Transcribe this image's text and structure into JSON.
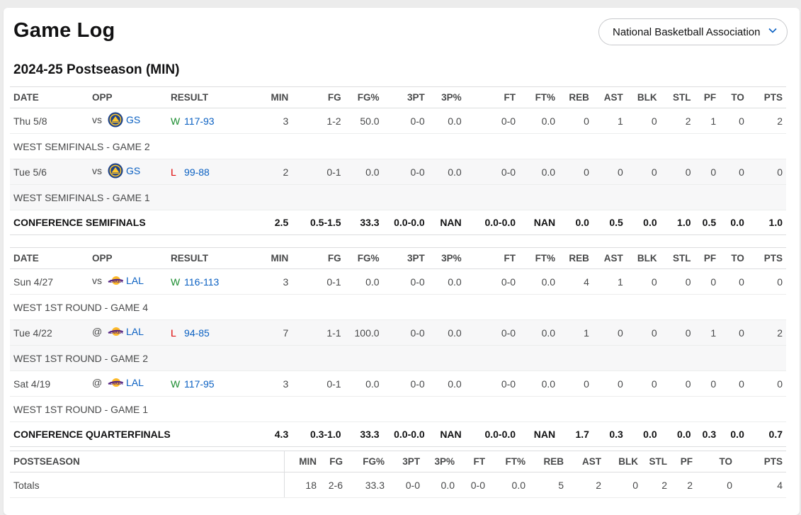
{
  "header": {
    "title": "Game Log",
    "league_select": "National Basketball Association"
  },
  "season_title": "2024-25 Postseason (MIN)",
  "columns": [
    "DATE",
    "OPP",
    "RESULT",
    "MIN",
    "FG",
    "FG%",
    "3PT",
    "3P%",
    "FT",
    "FT%",
    "REB",
    "AST",
    "BLK",
    "STL",
    "PF",
    "TO",
    "PTS"
  ],
  "colors": {
    "win": "#1a8c2f",
    "loss": "#dd0000",
    "link": "#0a60c2"
  },
  "sections": [
    {
      "games": [
        {
          "date": "Thu 5/8",
          "vs": "vs",
          "team": "GS",
          "team_icon": "warriors-logo-icon",
          "result": "W",
          "score": "117-93",
          "stats": [
            "3",
            "1-2",
            "50.0",
            "0-0",
            "0.0",
            "0-0",
            "0.0",
            "0",
            "1",
            "0",
            "2",
            "1",
            "0",
            "2"
          ],
          "note": "WEST SEMIFINALS - GAME 2"
        },
        {
          "date": "Tue 5/6",
          "vs": "vs",
          "team": "GS",
          "team_icon": "warriors-logo-icon",
          "result": "L",
          "score": "99-88",
          "stats": [
            "2",
            "0-1",
            "0.0",
            "0-0",
            "0.0",
            "0-0",
            "0.0",
            "0",
            "0",
            "0",
            "0",
            "0",
            "0",
            "0"
          ],
          "note": "WEST SEMIFINALS - GAME 1"
        }
      ],
      "summary": {
        "label": "CONFERENCE SEMIFINALS",
        "stats": [
          "2.5",
          "0.5-1.5",
          "33.3",
          "0.0-0.0",
          "NAN",
          "0.0-0.0",
          "NAN",
          "0.0",
          "0.5",
          "0.0",
          "1.0",
          "0.5",
          "0.0",
          "1.0"
        ]
      }
    },
    {
      "games": [
        {
          "date": "Sun 4/27",
          "vs": "vs",
          "team": "LAL",
          "team_icon": "lakers-logo-icon",
          "result": "W",
          "score": "116-113",
          "stats": [
            "3",
            "0-1",
            "0.0",
            "0-0",
            "0.0",
            "0-0",
            "0.0",
            "4",
            "1",
            "0",
            "0",
            "0",
            "0",
            "0"
          ],
          "note": "WEST 1ST ROUND - GAME 4"
        },
        {
          "date": "Tue 4/22",
          "vs": "@",
          "team": "LAL",
          "team_icon": "lakers-logo-icon",
          "result": "L",
          "score": "94-85",
          "stats": [
            "7",
            "1-1",
            "100.0",
            "0-0",
            "0.0",
            "0-0",
            "0.0",
            "1",
            "0",
            "0",
            "0",
            "1",
            "0",
            "2"
          ],
          "note": "WEST 1ST ROUND - GAME 2"
        },
        {
          "date": "Sat 4/19",
          "vs": "@",
          "team": "LAL",
          "team_icon": "lakers-logo-icon",
          "result": "W",
          "score": "117-95",
          "stats": [
            "3",
            "0-1",
            "0.0",
            "0-0",
            "0.0",
            "0-0",
            "0.0",
            "0",
            "0",
            "0",
            "0",
            "0",
            "0",
            "0"
          ],
          "note": "WEST 1ST ROUND - GAME 1"
        }
      ],
      "summary": {
        "label": "CONFERENCE QUARTERFINALS",
        "stats": [
          "4.3",
          "0.3-1.0",
          "33.3",
          "0.0-0.0",
          "NAN",
          "0.0-0.0",
          "NAN",
          "1.7",
          "0.3",
          "0.0",
          "0.0",
          "0.3",
          "0.0",
          "0.7"
        ]
      }
    }
  ],
  "totals": {
    "header_label": "POSTSEASON",
    "columns": [
      "MIN",
      "FG",
      "FG%",
      "3PT",
      "3P%",
      "FT",
      "FT%",
      "REB",
      "AST",
      "BLK",
      "STL",
      "PF",
      "TO",
      "PTS"
    ],
    "label": "Totals",
    "stats": [
      "18",
      "2-6",
      "33.3",
      "0-0",
      "0.0",
      "0-0",
      "0.0",
      "5",
      "2",
      "0",
      "2",
      "2",
      "0",
      "4"
    ]
  }
}
